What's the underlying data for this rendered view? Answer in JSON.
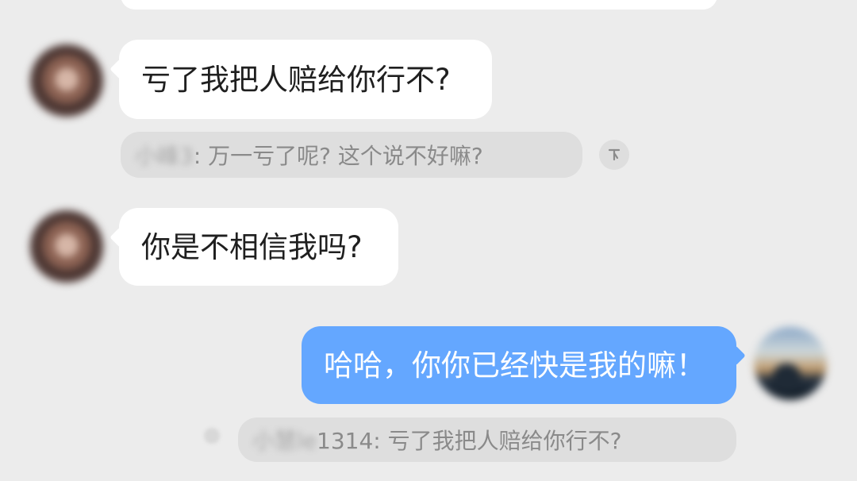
{
  "messages": [
    {
      "text": "亏了我把人赔给你行不?",
      "direction": "incoming"
    },
    {
      "text": "你是不相信我吗?",
      "direction": "incoming"
    },
    {
      "text": "哈哈，你你已经快是我的嘛！",
      "direction": "outgoing"
    }
  ],
  "quotes": [
    {
      "author_blurred": "小峰3",
      "text": ": 万一亏了呢? 这个说不好嘛?"
    },
    {
      "author_blurred": "小慧le",
      "text": "1314: 亏了我把人赔给你行不?"
    }
  ],
  "icons": {
    "toggle": "down-arrow-icon",
    "avatar_left": "avatar-icon",
    "avatar_right": "avatar-icon"
  },
  "colors": {
    "background": "#ececec",
    "incoming_bubble": "#ffffff",
    "outgoing_bubble": "#64a7ff",
    "quote_bubble": "#dedede",
    "text_dark": "#1f1f1f",
    "text_muted": "#8b8b8b"
  }
}
